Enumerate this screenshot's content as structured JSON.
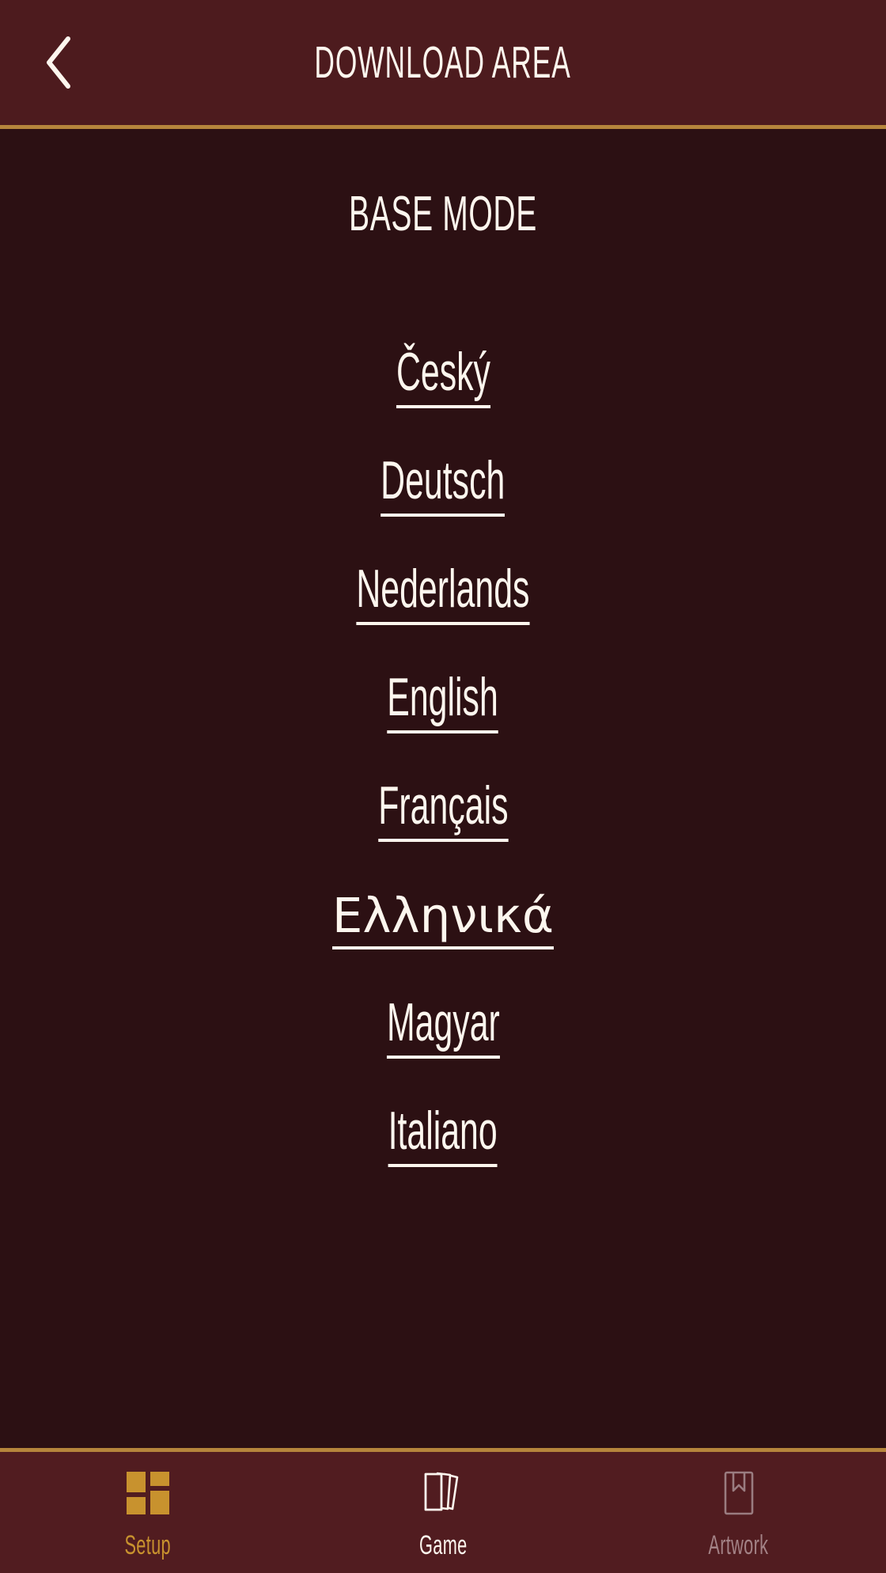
{
  "header": {
    "title": "DOWNLOAD AREA",
    "back_icon": "chevron-left-icon"
  },
  "main": {
    "section_title": "BASE MODE",
    "languages": [
      {
        "label": "Český"
      },
      {
        "label": "Deutsch"
      },
      {
        "label": "Nederlands"
      },
      {
        "label": "English"
      },
      {
        "label": "Français"
      },
      {
        "label": "Ελληνικά"
      },
      {
        "label": "Magyar"
      },
      {
        "label": "Italiano"
      }
    ]
  },
  "tabbar": {
    "tabs": [
      {
        "label": "Setup",
        "icon": "grid-tiles-icon",
        "state": "active"
      },
      {
        "label": "Game",
        "icon": "cards-fan-icon",
        "state": "normal"
      },
      {
        "label": "Artwork",
        "icon": "book-bookmark-icon",
        "state": "dim"
      }
    ]
  },
  "colors": {
    "header_bg": "#4d1b1e",
    "body_bg": "#2c1013",
    "tabbar_bg": "#511c20",
    "accent_gold": "#b6853c",
    "active_gold": "#c8922e",
    "text_light": "#fdf6ee",
    "text_dim": "#a38286"
  }
}
